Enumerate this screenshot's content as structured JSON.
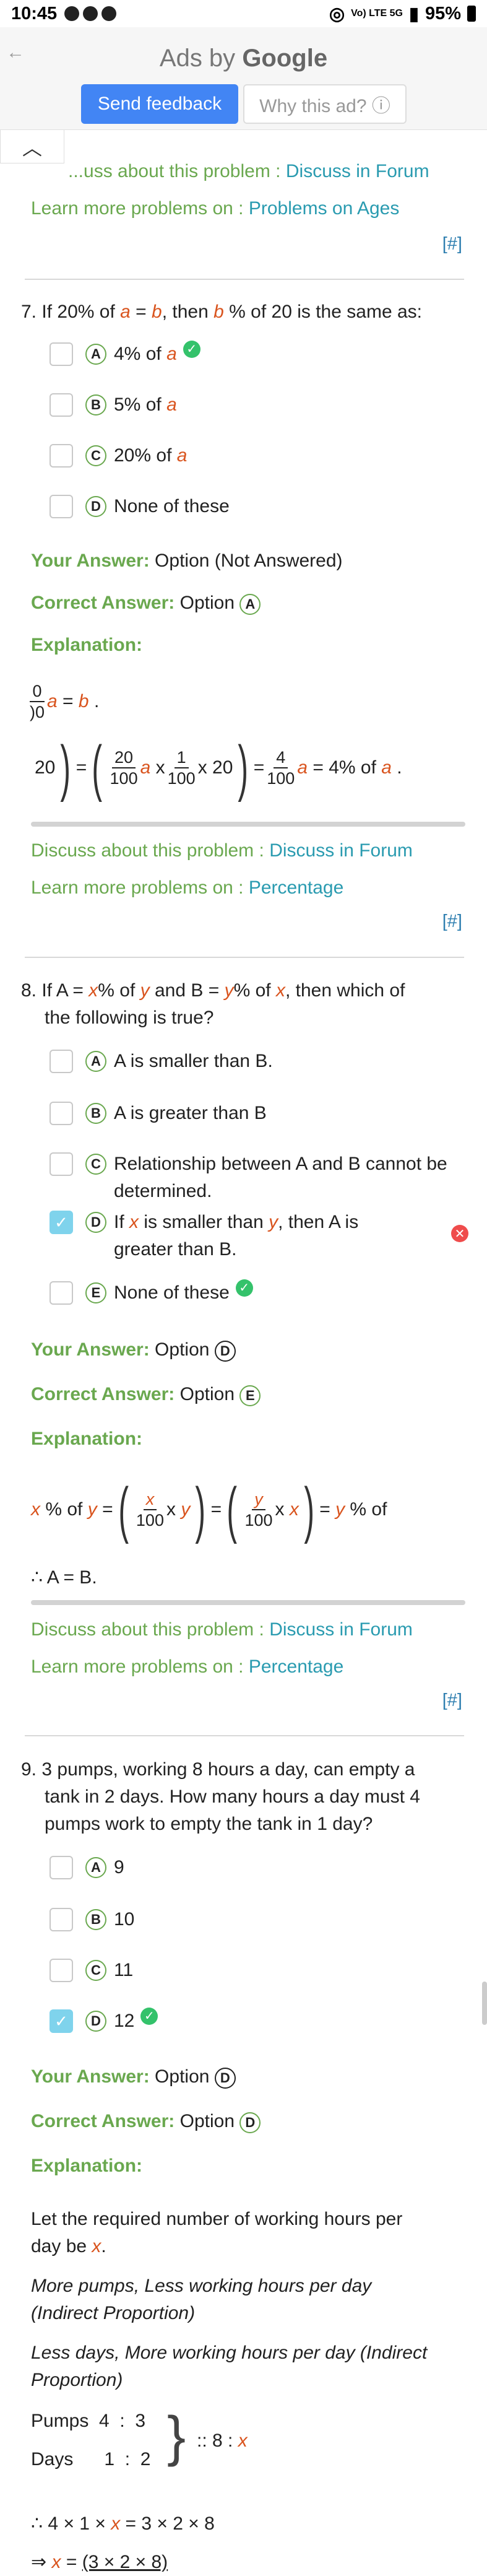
{
  "status": {
    "time": "10:45",
    "network": "Vo) LTE 5G",
    "battery": "95%"
  },
  "ad": {
    "ads_by": "Ads by",
    "google": "Google",
    "feedback": "Send feedback",
    "why": "Why this ad? ⓘ"
  },
  "prev": {
    "discuss_prefix": "...uss about this problem :",
    "discuss_link": "Discuss in Forum",
    "learn_prefix": "Learn more problems on :",
    "learn_link": "Problems on Ages",
    "hash": "[#]"
  },
  "q7": {
    "num": "7.",
    "q_pre": "If 20% of",
    "a": "a",
    "eq": "=",
    "b": "b",
    "q_mid": ", then",
    "q_post": "% of 20 is the same as:",
    "options": [
      {
        "letter": "A",
        "text": "4% of",
        "var": "a"
      },
      {
        "letter": "B",
        "text": "5% of",
        "var": "a"
      },
      {
        "letter": "C",
        "text": "20% of",
        "var": "a"
      },
      {
        "letter": "D",
        "text": "None of these",
        "var": ""
      }
    ],
    "your_label": "Your Answer:",
    "your_val": "Option (Not Answered)",
    "correct_label": "Correct Answer:",
    "correct_val": "Option",
    "correct_letter": "A",
    "expl_label": "Explanation:",
    "expl_line1_pre": "0",
    "expl_line1_den": ")0",
    "expl_line1_eq": "=",
    "expl_line2": {
      "lead": "20",
      "eq": "=",
      "n1": "20",
      "d1": "100",
      "x1": "x",
      "n2": "1",
      "d2": "100",
      "x2": "x 20",
      "eq2": "=",
      "n3": "4",
      "d3": "100",
      "tail": "= 4% of"
    },
    "discuss_prefix": "Discuss about this problem :",
    "discuss_link": "Discuss in Forum",
    "learn_prefix": "Learn more problems on :",
    "learn_link": "Percentage",
    "hash": "[#]"
  },
  "q8": {
    "num": "8.",
    "l1_pre": "If A =",
    "x": "x",
    "l1_mid": "% of",
    "y": "y",
    "l1_mid2": "and B =",
    "l1_mid3": "% of",
    "l1_post": ", then which of",
    "l2": "the following is true?",
    "options": [
      {
        "letter": "A",
        "text": "A is smaller than B."
      },
      {
        "letter": "B",
        "text": "A is greater than B"
      },
      {
        "letter": "C",
        "text": "Relationship between A and B cannot be",
        "text2": "determined."
      },
      {
        "letter": "D",
        "text_pre": "If",
        "text_mid": "is smaller than",
        "text_post": ", then A is",
        "text2": "greater than B."
      },
      {
        "letter": "E",
        "text": "None of these"
      }
    ],
    "your_label": "Your Answer:",
    "your_val": "Option",
    "your_letter": "D",
    "correct_label": "Correct Answer:",
    "correct_val": "Option",
    "correct_letter": "E",
    "expl_label": "Explanation:",
    "expl_math": {
      "pct": "% of",
      "eq": "=",
      "x": "x",
      "n1": "x",
      "d1": "100",
      "times": "x",
      "n2": "y",
      "d2": "100",
      "tail": "% of"
    },
    "therefore": "∴  A = B.",
    "discuss_prefix": "Discuss about this problem :",
    "discuss_link": "Discuss in Forum",
    "learn_prefix": "Learn more problems on :",
    "learn_link": "Percentage",
    "hash": "[#]"
  },
  "q9": {
    "num": "9.",
    "l1": "3 pumps, working 8 hours a day, can empty a",
    "l2": "tank in 2 days. How many hours a day must 4",
    "l3": "pumps work to empty the tank in 1 day?",
    "options": [
      {
        "letter": "A",
        "text": "9"
      },
      {
        "letter": "B",
        "text": "10"
      },
      {
        "letter": "C",
        "text": "11"
      },
      {
        "letter": "D",
        "text": "12"
      }
    ],
    "your_label": "Your Answer:",
    "your_val": "Option",
    "your_letter": "D",
    "correct_label": "Correct Answer:",
    "correct_val": "Option",
    "correct_letter": "D",
    "expl_label": "Explanation:",
    "e1": "Let the required number of working hours per",
    "e2_pre": "day be",
    "e2_post": ".",
    "e3": "More pumps, Less working hours per day",
    "e4": "(Indirect Proportion)",
    "e5": "Less days, More working hours per day (Indirect",
    "e6": "Proportion)",
    "pumps": "Pumps  4  :  3",
    "days": "Days      1  :  2",
    "ratio": ":: 8 :",
    "final1": "∴  4 × 1 ×",
    "final1_post": "= 3 × 2 × 8",
    "final2_pre": "⇒",
    "final2_eq": "=",
    "final2_num": "(3 × 2 × 8)"
  }
}
